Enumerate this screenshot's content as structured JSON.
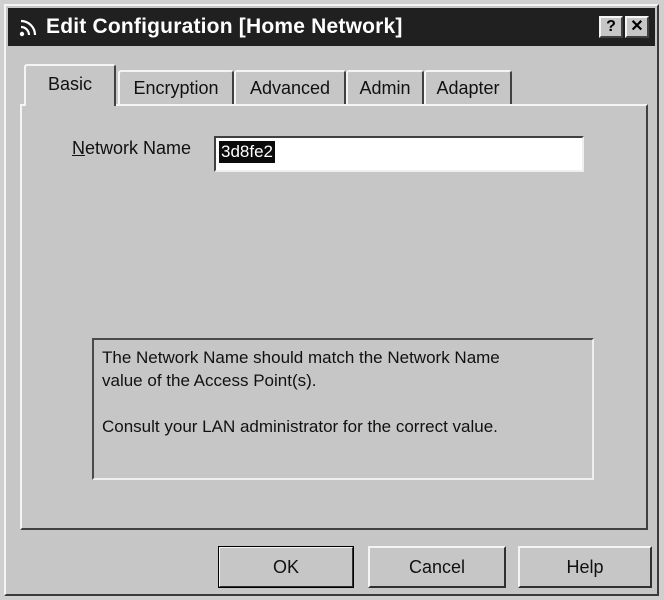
{
  "window": {
    "title": "Edit Configuration [Home Network]",
    "help_glyph": "?",
    "close_glyph": "✕"
  },
  "tabs": [
    {
      "label": "Basic",
      "active": true
    },
    {
      "label": "Encryption",
      "active": false
    },
    {
      "label": "Advanced",
      "active": false
    },
    {
      "label": "Admin",
      "active": false
    },
    {
      "label": "Adapter",
      "active": false
    }
  ],
  "basic": {
    "network_name_label_first": "N",
    "network_name_label_rest": "etwork Name",
    "network_name_value": "3d8fe2",
    "info_line1": "The Network Name should match the Network Name",
    "info_line2": "value of the Access Point(s).",
    "info_line3": "Consult your LAN administrator for the correct value."
  },
  "buttons": {
    "ok": "OK",
    "cancel": "Cancel",
    "help": "Help"
  },
  "icons": {
    "title": "wireless-signal-icon"
  }
}
